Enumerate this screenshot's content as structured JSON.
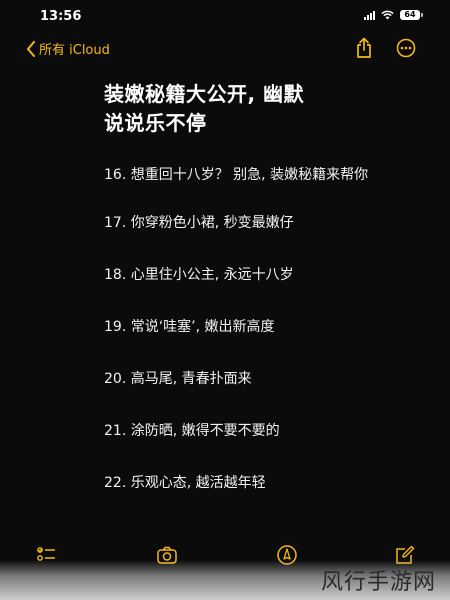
{
  "status": {
    "time": "13:56",
    "battery": "64",
    "icons": [
      "signal-icon",
      "wifi-icon",
      "battery-icon"
    ]
  },
  "nav": {
    "back_label": "所有 iCloud",
    "icons": [
      "chevron-left-icon",
      "share-icon",
      "more-icon"
    ]
  },
  "note": {
    "title_line1": "装嫩秘籍大公开, 幽默",
    "title_line2": "说说乐不停",
    "items": [
      "16. 想重回十八岁？ 别急, 装嫩秘籍来帮你",
      "17. 你穿粉色小裙, 秒变最嫩仔",
      "18. 心里住小公主, 永远十八岁",
      "19. 常说‘哇塞’, 嫩出新高度",
      "20. 高马尾, 青春扑面来",
      "21. 涂防晒, 嫩得不要不要的",
      "22. 乐观心态, 越活越年轻"
    ]
  },
  "toolbar": {
    "icons": [
      "checklist-icon",
      "camera-icon",
      "markup-icon",
      "compose-icon"
    ]
  },
  "watermark": "风行手游网",
  "colors": {
    "accent": "#f5b916",
    "background": "#0b0b0b",
    "text": "#ffffff"
  }
}
